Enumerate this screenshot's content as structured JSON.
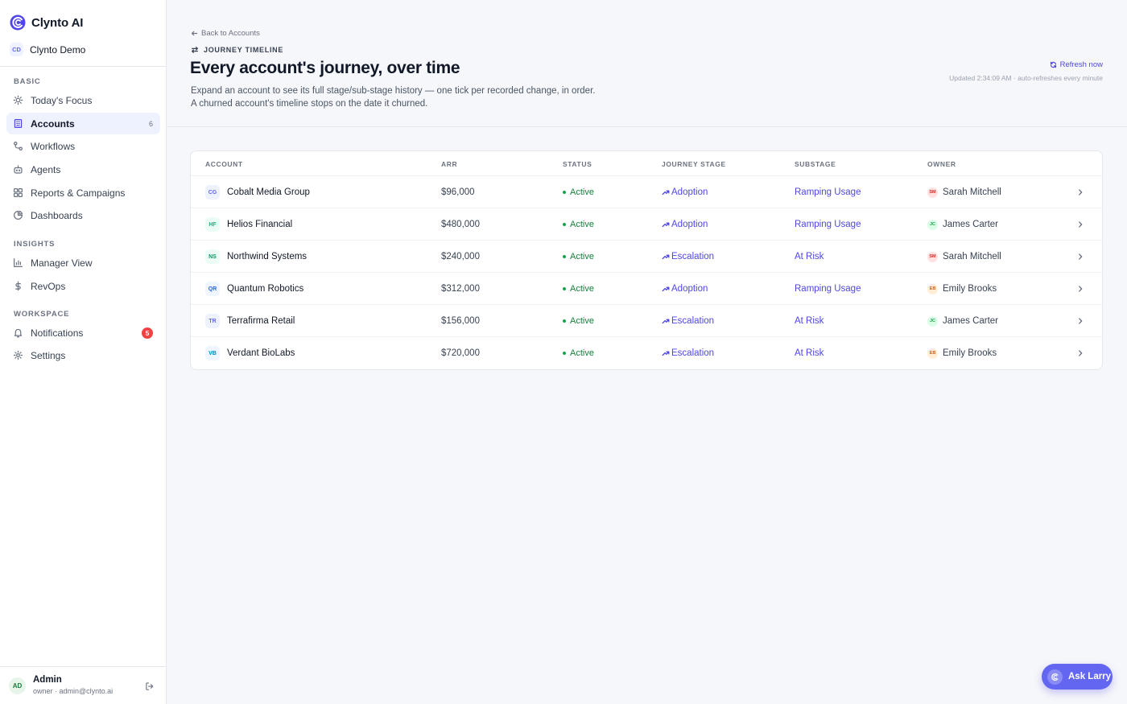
{
  "app": {
    "name": "Clynto AI",
    "org_initials": "CD",
    "org_name": "Clynto Demo"
  },
  "sidebar": {
    "sections": {
      "basic": "BASIC",
      "insights": "INSIGHTS",
      "workspace": "WORKSPACE"
    },
    "items": [
      {
        "label": "Today's Focus",
        "icon": "sun-icon"
      },
      {
        "label": "Accounts",
        "icon": "building-icon",
        "count": "6",
        "active": true
      },
      {
        "label": "Workflows",
        "icon": "workflow-icon"
      },
      {
        "label": "Agents",
        "icon": "bot-icon"
      },
      {
        "label": "Reports & Campaigns",
        "icon": "grid-icon"
      },
      {
        "label": "Dashboards",
        "icon": "pie-chart-icon"
      },
      {
        "label": "Manager View",
        "icon": "bar-chart-icon"
      },
      {
        "label": "RevOps",
        "icon": "dollar-icon"
      },
      {
        "label": "Notifications",
        "icon": "bell-icon",
        "badge": "5"
      },
      {
        "label": "Settings",
        "icon": "gear-icon"
      }
    ],
    "user": {
      "initials": "AD",
      "name": "Admin",
      "meta": "owner · admin@clynto.ai"
    }
  },
  "header": {
    "back_label": "Back to Accounts",
    "eyebrow": "JOURNEY TIMELINE",
    "title": "Every account's journey, over time",
    "description": "Expand an account to see its full stage/sub-stage history — one tick per recorded change, in order. A churned account's timeline stops on the date it churned.",
    "refresh_label": "Refresh now",
    "updated_text": "Updated 2:34:09 AM · auto-refreshes every minute"
  },
  "table": {
    "columns": {
      "account": "ACCOUNT",
      "arr": "ARR",
      "status": "STATUS",
      "stage": "JOURNEY STAGE",
      "substage": "SUBSTAGE",
      "owner": "OWNER"
    },
    "rows": [
      {
        "initials": "CG",
        "account": "Cobalt Media Group",
        "arr": "$96,000",
        "status": "Active",
        "stage": "Adoption",
        "substage": "Ramping Usage",
        "owner_initials": "SM",
        "owner": "Sarah Mitchell"
      },
      {
        "initials": "HF",
        "account": "Helios Financial",
        "arr": "$480,000",
        "status": "Active",
        "stage": "Adoption",
        "substage": "Ramping Usage",
        "owner_initials": "JC",
        "owner": "James Carter"
      },
      {
        "initials": "NS",
        "account": "Northwind Systems",
        "arr": "$240,000",
        "status": "Active",
        "stage": "Escalation",
        "substage": "At Risk",
        "owner_initials": "SM",
        "owner": "Sarah Mitchell"
      },
      {
        "initials": "QR",
        "account": "Quantum Robotics",
        "arr": "$312,000",
        "status": "Active",
        "stage": "Adoption",
        "substage": "Ramping Usage",
        "owner_initials": "EB",
        "owner": "Emily Brooks"
      },
      {
        "initials": "TR",
        "account": "Terrafirma Retail",
        "arr": "$156,000",
        "status": "Active",
        "stage": "Escalation",
        "substage": "At Risk",
        "owner_initials": "JC",
        "owner": "James Carter"
      },
      {
        "initials": "VB",
        "account": "Verdant BioLabs",
        "arr": "$720,000",
        "status": "Active",
        "stage": "Escalation",
        "substage": "At Risk",
        "owner_initials": "EB",
        "owner": "Emily Brooks"
      }
    ]
  },
  "assistant": {
    "label": "Ask Larry"
  },
  "colors": {
    "accent": "#4f46e5",
    "status_active": "#15803d",
    "badge_red": "#ef4444"
  }
}
